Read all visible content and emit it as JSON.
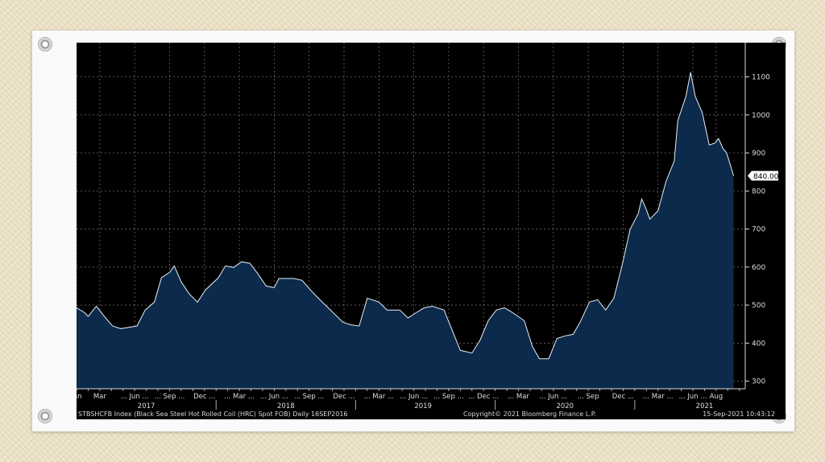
{
  "chart_data": {
    "type": "area",
    "title": "STBSHCFB Index (Black Sea Steel Hot Rolled Coil (HRC) Spot FOB)  Daily 16SEP2016",
    "copyright": "Copyright© 2021 Bloomberg Finance L.P.",
    "timestamp": "15-Sep-2021 10:43:12",
    "last_value_label": "840.00",
    "x_unit": "months since Jan 2017",
    "xlim": [
      0,
      57.5
    ],
    "ylim": [
      280,
      1190
    ],
    "y_ticks": [
      300,
      400,
      500,
      600,
      700,
      800,
      900,
      1000,
      1100
    ],
    "x_tick_labels": [
      {
        "m": 0,
        "t": "Jan"
      },
      {
        "m": 2,
        "t": "Mar"
      },
      {
        "m": 5,
        "t": "... Jun ..."
      },
      {
        "m": 8,
        "t": "... Sep ..."
      },
      {
        "m": 11,
        "t": "Dec ..."
      },
      {
        "m": 14,
        "t": "... Mar ..."
      },
      {
        "m": 17,
        "t": "... Jun ..."
      },
      {
        "m": 20,
        "t": "... Sep ..."
      },
      {
        "m": 23,
        "t": "Dec ..."
      },
      {
        "m": 26,
        "t": "... Mar ..."
      },
      {
        "m": 29,
        "t": "... Jun ..."
      },
      {
        "m": 32,
        "t": "... Sep ..."
      },
      {
        "m": 35,
        "t": "... Dec ..."
      },
      {
        "m": 38,
        "t": "... Mar"
      },
      {
        "m": 41,
        "t": "... Jun ..."
      },
      {
        "m": 44,
        "t": "... Sep"
      },
      {
        "m": 47,
        "t": "Dec ..."
      },
      {
        "m": 50,
        "t": "... Mar ..."
      },
      {
        "m": 53,
        "t": "... Jun ..."
      },
      {
        "m": 55,
        "t": "Aug"
      }
    ],
    "year_labels": [
      {
        "m": 6,
        "t": "2017"
      },
      {
        "m": 18,
        "t": "2018"
      },
      {
        "m": 29.8,
        "t": "2019"
      },
      {
        "m": 42,
        "t": "2020"
      },
      {
        "m": 54,
        "t": "2021"
      }
    ],
    "year_separators": [
      12,
      24,
      36,
      48
    ],
    "grid": true,
    "colors": {
      "fill": "#0c2a4c",
      "line": "#e8eef5",
      "background": "#000000",
      "grid": "#6a6a6a"
    },
    "series": [
      {
        "name": "STBSHCFB Index",
        "points": [
          [
            0,
            493
          ],
          [
            0.7,
            480
          ],
          [
            1,
            470
          ],
          [
            1.7,
            497
          ],
          [
            2.4,
            470
          ],
          [
            3.1,
            445
          ],
          [
            3.8,
            438
          ],
          [
            4.2,
            440
          ],
          [
            5.2,
            445
          ],
          [
            5.9,
            487
          ],
          [
            6.7,
            508
          ],
          [
            7.3,
            572
          ],
          [
            8,
            586
          ],
          [
            8.4,
            603
          ],
          [
            9,
            561
          ],
          [
            9.7,
            529
          ],
          [
            10.4,
            508
          ],
          [
            11.1,
            540
          ],
          [
            12.2,
            572
          ],
          [
            12.8,
            603
          ],
          [
            13.5,
            599
          ],
          [
            14.2,
            614
          ],
          [
            14.9,
            610
          ],
          [
            15.6,
            582
          ],
          [
            16.3,
            550
          ],
          [
            17,
            546
          ],
          [
            17.4,
            570
          ],
          [
            18.7,
            570
          ],
          [
            19.4,
            565
          ],
          [
            20.1,
            540
          ],
          [
            20.8,
            518
          ],
          [
            21.5,
            497
          ],
          [
            22.2,
            476
          ],
          [
            22.9,
            455
          ],
          [
            23.6,
            448
          ],
          [
            24.3,
            445
          ],
          [
            25,
            518
          ],
          [
            26,
            508
          ],
          [
            26.7,
            487
          ],
          [
            27.8,
            487
          ],
          [
            28.5,
            466
          ],
          [
            29.2,
            480
          ],
          [
            29.9,
            493
          ],
          [
            30.6,
            497
          ],
          [
            31.6,
            487
          ],
          [
            32.3,
            434
          ],
          [
            33,
            381
          ],
          [
            34,
            374
          ],
          [
            34.7,
            408
          ],
          [
            35.4,
            459
          ],
          [
            36.1,
            487
          ],
          [
            36.8,
            493
          ],
          [
            37.5,
            480
          ],
          [
            38.5,
            459
          ],
          [
            39.2,
            391
          ],
          [
            39.8,
            359
          ],
          [
            40.6,
            359
          ],
          [
            41.3,
            412
          ],
          [
            42,
            419
          ],
          [
            42.7,
            423
          ],
          [
            43.3,
            455
          ],
          [
            44.1,
            508
          ],
          [
            44.8,
            514
          ],
          [
            45.5,
            487
          ],
          [
            46.2,
            518
          ],
          [
            46.9,
            603
          ],
          [
            47.6,
            699
          ],
          [
            48.3,
            741
          ],
          [
            48.6,
            779
          ],
          [
            49,
            751
          ],
          [
            49.3,
            726
          ],
          [
            50,
            748
          ],
          [
            50.7,
            826
          ],
          [
            51.4,
            879
          ],
          [
            51.7,
            985
          ],
          [
            52.4,
            1049
          ],
          [
            52.8,
            1112
          ],
          [
            53.2,
            1049
          ],
          [
            53.8,
            1006
          ],
          [
            54.4,
            921
          ],
          [
            54.9,
            926
          ],
          [
            55.2,
            938
          ],
          [
            55.6,
            911
          ],
          [
            55.9,
            900
          ],
          [
            56.5,
            840
          ]
        ]
      }
    ]
  }
}
